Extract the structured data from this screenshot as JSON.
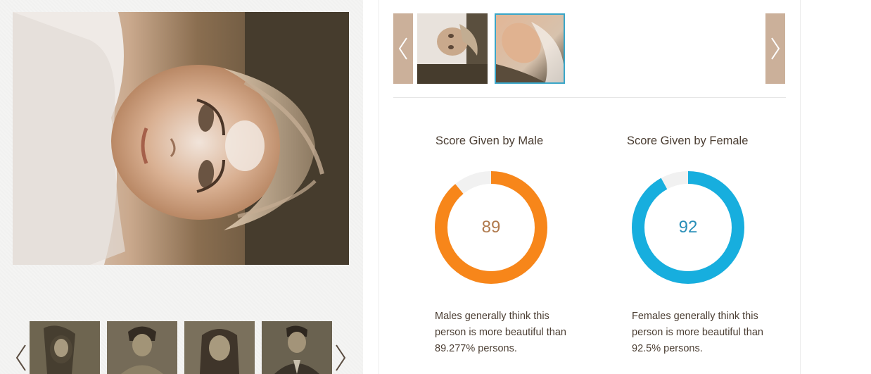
{
  "left": {
    "main_photo": {
      "icon": "portrait-photo",
      "alt": ""
    },
    "strip": {
      "thumbnails": [
        {
          "icon": "portrait-thumbnail"
        },
        {
          "icon": "portrait-thumbnail"
        },
        {
          "icon": "portrait-thumbnail"
        },
        {
          "icon": "portrait-thumbnail"
        }
      ]
    }
  },
  "right": {
    "carousel": {
      "thumbnails": [
        {
          "icon": "portrait-thumbnail",
          "selected": false
        },
        {
          "icon": "portrait-thumbnail",
          "selected": true
        }
      ]
    },
    "male": {
      "title": "Score Given by Male",
      "score": "89",
      "score_value": 89,
      "color": "#f7861a",
      "description": "Males generally think this person is more beautiful than 89.277% persons."
    },
    "female": {
      "title": "Score Given by Female",
      "score": "92",
      "score_value": 92,
      "color": "#17aede",
      "description": "Females generally think this person is more beautiful than 92.5% persons."
    }
  },
  "colors": {
    "accent_border": "#3aa6c8",
    "arrow_bg": "#cbb09a",
    "text": "#4b3e33",
    "track": "#f1f1f1"
  }
}
